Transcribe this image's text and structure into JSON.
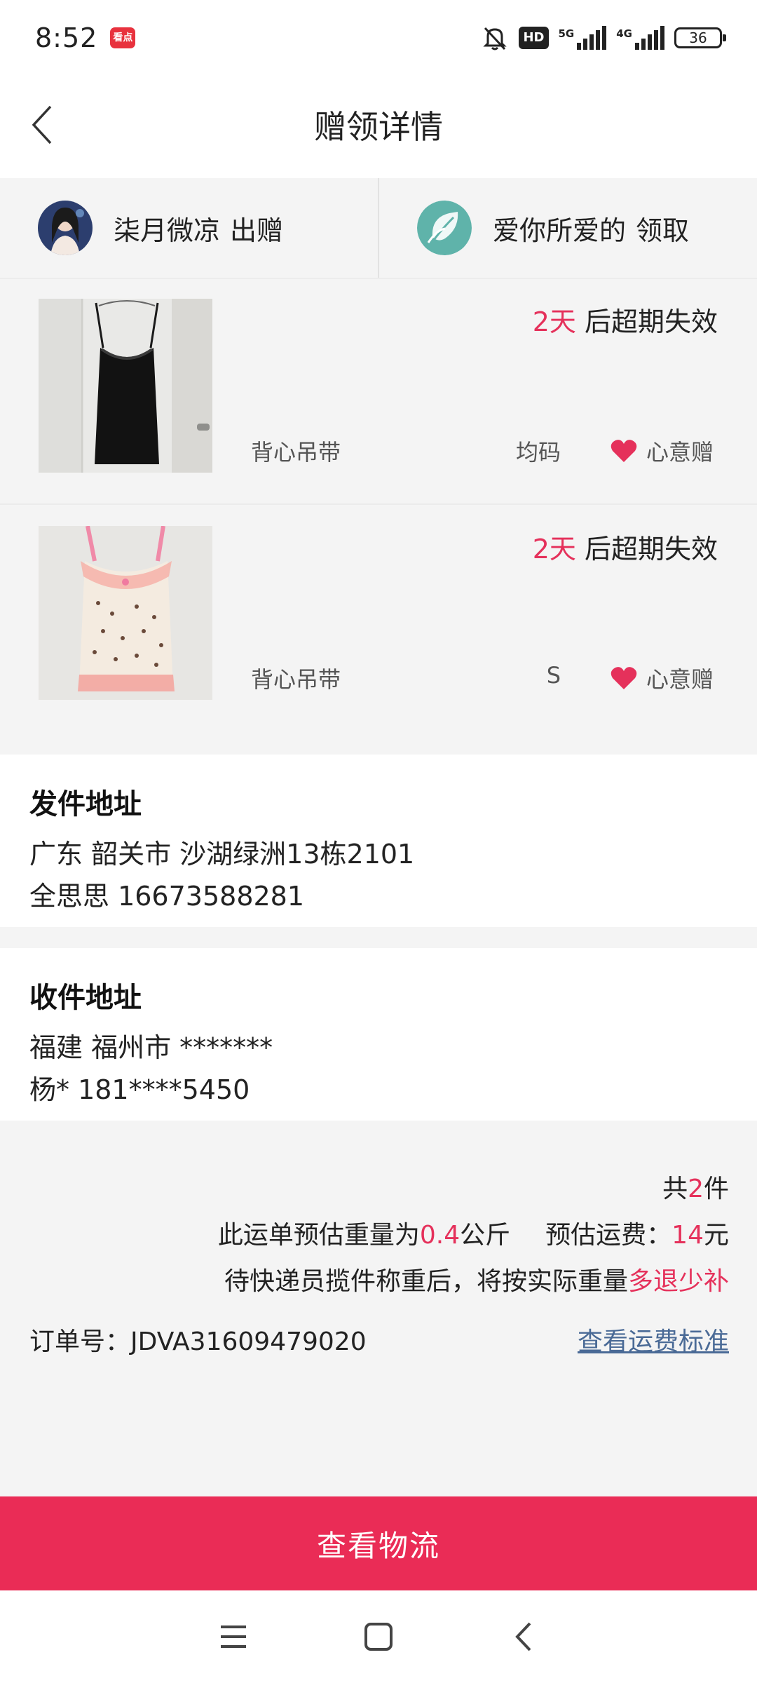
{
  "status_bar": {
    "time": "8:52",
    "app_icon_text": "看点",
    "hd_badge": "HD",
    "net1": "5G",
    "net2": "4G",
    "battery": "36"
  },
  "header": {
    "title": "赠领详情"
  },
  "users": {
    "giver_name": "柒月微凉",
    "giver_action": "出赠",
    "receiver_name": "爱你所爱的",
    "receiver_action": "领取"
  },
  "items": [
    {
      "expire_days": "2天",
      "expire_suffix": " 后超期失效",
      "name": "背心吊带",
      "size": "均码",
      "tag": "心意赠"
    },
    {
      "expire_days": "2天",
      "expire_suffix": " 后超期失效",
      "name": "背心吊带",
      "size": "S",
      "tag": "心意赠"
    }
  ],
  "send_address": {
    "title": "发件地址",
    "line1": "广东 韶关市 沙湖绿洲13栋2101",
    "line2": "全思思 16673588281"
  },
  "recv_address": {
    "title": "收件地址",
    "line1": "福建 福州市 *******",
    "line2": "杨* 181****5450"
  },
  "summary": {
    "count_prefix": "共",
    "count": "2",
    "count_suffix": "件",
    "weight_prefix": "此运单预估重量为",
    "weight": "0.4",
    "weight_unit": "公斤",
    "fee_prefix": "预估运费：",
    "fee": "14",
    "fee_unit": "元",
    "note_prefix": "待快递员揽件称重后，将按实际重量",
    "note_highlight": "多退少补",
    "order_label": "订单号：",
    "order_no": "JDVA31609479020",
    "fee_link": "查看运费标准"
  },
  "bottom_button": "查看物流",
  "colors": {
    "accent": "#ea2c56",
    "highlight_text": "#e5315b",
    "link": "#4a6a96"
  }
}
